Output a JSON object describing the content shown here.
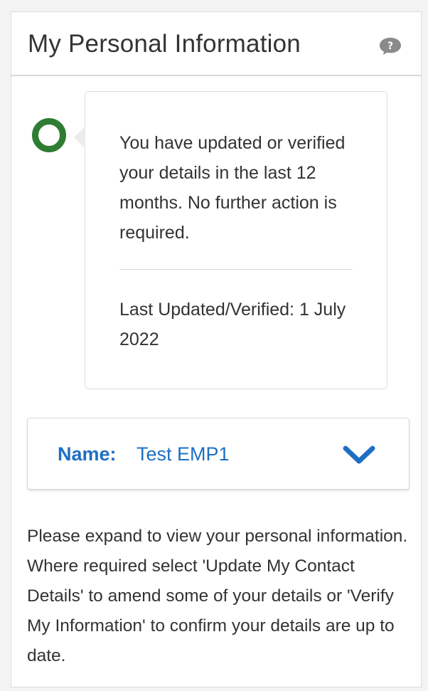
{
  "panel": {
    "title": "My Personal Information",
    "help_icon": "question-speech-bubble-icon"
  },
  "status": {
    "indicator_icon": "green-ring-icon",
    "indicator_color": "#2e7d32",
    "message": "You have updated or verified your details in the last 12 months. No further action is required.",
    "last_updated": "Last Updated/Verified: 1 July 2022"
  },
  "name_row": {
    "label": "Name:",
    "value": "Test EMP1",
    "expand_icon": "chevron-down-icon",
    "accent_color": "#1e6fc4"
  },
  "info": {
    "text": "Please expand to view your personal information. Where required select 'Update My Contact Details' to amend some of your details or 'Verify My Information' to confirm your details are up to date."
  }
}
